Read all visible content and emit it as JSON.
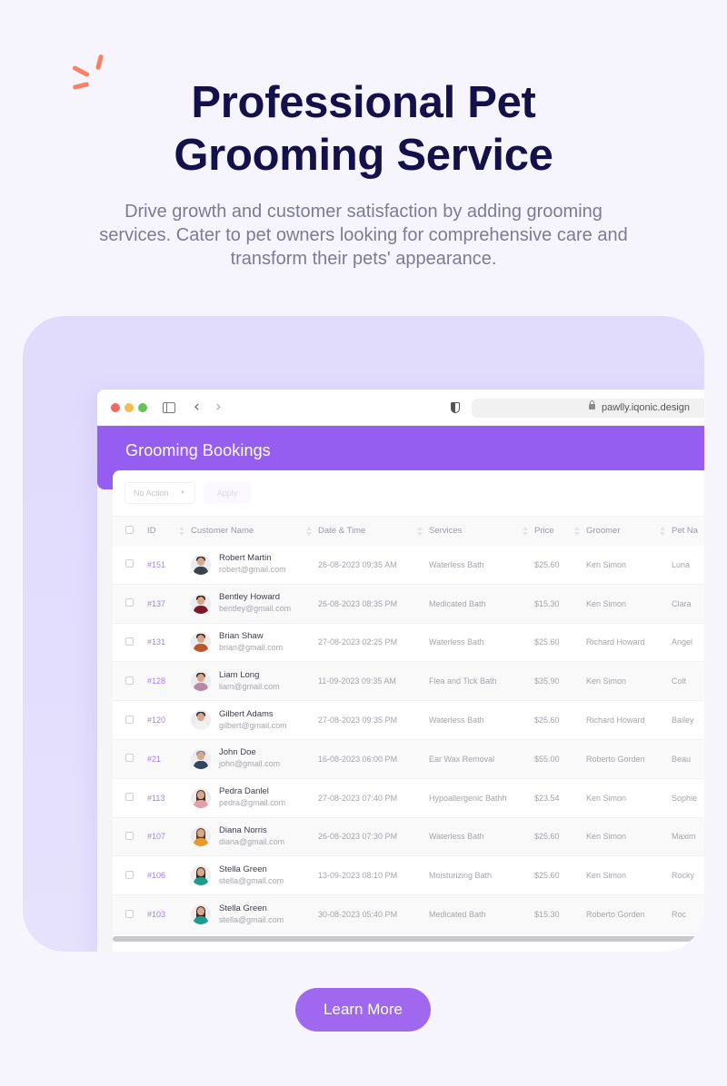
{
  "hero": {
    "title_line1": "Professional Pet",
    "title_line2": "Grooming Service",
    "subtitle": "Drive growth and customer satisfaction by adding grooming services. Cater to pet owners looking for comprehensive care and transform their pets' appearance."
  },
  "browser": {
    "url": "pawlly.iqonic.design",
    "icons": [
      "close-dot",
      "minimize-dot",
      "maximize-dot",
      "sidebar-icon",
      "back-icon",
      "forward-icon",
      "shield-icon",
      "lock-icon"
    ]
  },
  "page": {
    "title": "Grooming Bookings",
    "bulk_action": {
      "selected": "No Action",
      "apply_label": "Apply"
    }
  },
  "table": {
    "columns": [
      "ID",
      "Customer Name",
      "Date & Time",
      "Services",
      "Price",
      "Groomer",
      "Pet Na"
    ],
    "rows": [
      {
        "id": "#151",
        "name": "Robert Martin",
        "email": "robert@gmail.com",
        "datetime": "26-08-2023 09:35 AM",
        "service": "Waterless Bath",
        "price": "$25.60",
        "groomer": "Ken Simon",
        "pet": "Luna"
      },
      {
        "id": "#137",
        "name": "Bentley Howard",
        "email": "bentley@gmail.com",
        "datetime": "26-08-2023 08:35 PM",
        "service": "Medicated Bath",
        "price": "$15.30",
        "groomer": "Ken Simon",
        "pet": "Clara"
      },
      {
        "id": "#131",
        "name": "Brian Shaw",
        "email": "brian@gmail.com",
        "datetime": "27-08-2023 02:25 PM",
        "service": "Waterless Bath",
        "price": "$25.60",
        "groomer": "Richard Howard",
        "pet": "Angel"
      },
      {
        "id": "#128",
        "name": "Liam Long",
        "email": "liam@gmail.com",
        "datetime": "11-09-2023 09:35 AM",
        "service": "Flea and Tick Bath",
        "price": "$35.90",
        "groomer": "Ken Simon",
        "pet": "Colt"
      },
      {
        "id": "#120",
        "name": "Gilbert Adams",
        "email": "gilbert@gmail.com",
        "datetime": "27-08-2023 09:35 PM",
        "service": "Waterless Bath",
        "price": "$25.60",
        "groomer": "Richard Howard",
        "pet": "Bailey"
      },
      {
        "id": "#21",
        "name": "John Doe",
        "email": "john@gmail.com",
        "datetime": "16-08-2023 06:00 PM",
        "service": "Ear Wax Removal",
        "price": "$55.00",
        "groomer": "Roberto Gorden",
        "pet": "Beau"
      },
      {
        "id": "#113",
        "name": "Pedra Danlel",
        "email": "pedra@gmail.com",
        "datetime": "27-08-2023 07:40 PM",
        "service": "Hypoallergenic Bathh",
        "price": "$23.54",
        "groomer": "Ken Simon",
        "pet": "Sophie"
      },
      {
        "id": "#107",
        "name": "Diana Norris",
        "email": "diana@gmail.com",
        "datetime": "26-08-2023 07:30 PM",
        "service": "Waterless Bath",
        "price": "$25.60",
        "groomer": "Ken Simon",
        "pet": "Maxim"
      },
      {
        "id": "#106",
        "name": "Stella Green",
        "email": "stella@gmail.com",
        "datetime": "13-09-2023 08:10 PM",
        "service": "Moisturizing Bath",
        "price": "$25.60",
        "groomer": "Ken Simon",
        "pet": "Rocky"
      },
      {
        "id": "#103",
        "name": "Stella Green",
        "email": "stella@gmail.com",
        "datetime": "30-08-2023 05:40 PM",
        "service": "Medicated Bath",
        "price": "$15.30",
        "groomer": "Roberto Gorden",
        "pet": "Roc"
      }
    ],
    "avatar_colors": [
      {
        "shirt": "#3b4350",
        "hair": "#3a2a20",
        "long": false
      },
      {
        "shirt": "#7a1a26",
        "hair": "#2d1a12",
        "long": false
      },
      {
        "shirt": "#b8582a",
        "hair": "#2f2118",
        "long": false
      },
      {
        "shirt": "#b788a8",
        "hair": "#3a2a1e",
        "long": false
      },
      {
        "shirt": "#f2f2f2",
        "hair": "#2a2a2a",
        "long": false
      },
      {
        "shirt": "#2f4560",
        "hair": "#8a8a8a",
        "long": false
      },
      {
        "shirt": "#e2a0aa",
        "hair": "#4a2a1a",
        "long": true
      },
      {
        "shirt": "#e79a2c",
        "hair": "#6a3a18",
        "long": true
      },
      {
        "shirt": "#1f9a8e",
        "hair": "#3a2418",
        "long": true
      },
      {
        "shirt": "#1f9a8e",
        "hair": "#3a2418",
        "long": true
      }
    ]
  },
  "cta": {
    "label": "Learn More"
  },
  "colors": {
    "brand_purple": "#965ef0",
    "button_purple": "#9f68ee",
    "title_navy": "#13104a",
    "accent_coral": "#fb7f61",
    "id_link": "#a77ef3"
  }
}
